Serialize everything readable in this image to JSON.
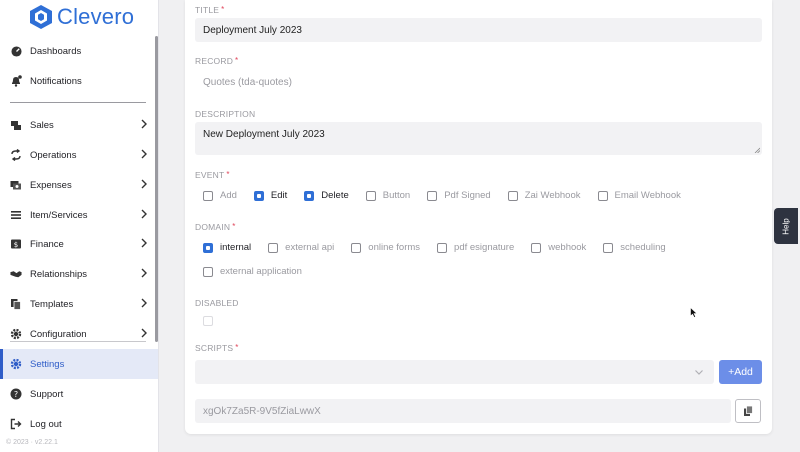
{
  "app": {
    "brand": "Clevero",
    "version": "© 2023 · v2.22.1",
    "accent": "#2f6fd6"
  },
  "sidebar": {
    "items": [
      {
        "label": "Dashboards",
        "icon": "dashboard-icon"
      },
      {
        "label": "Notifications",
        "icon": "bell-icon"
      },
      {
        "label": "Sales",
        "icon": "sales-icon"
      },
      {
        "label": "Operations",
        "icon": "sync-icon"
      },
      {
        "label": "Expenses",
        "icon": "expenses-icon"
      },
      {
        "label": "Item/Services",
        "icon": "list-icon"
      },
      {
        "label": "Finance",
        "icon": "finance-icon"
      },
      {
        "label": "Relationships",
        "icon": "handshake-icon"
      },
      {
        "label": "Templates",
        "icon": "templates-icon"
      },
      {
        "label": "Configuration",
        "icon": "gear-icon"
      },
      {
        "label": "Settings",
        "icon": "gear-icon"
      },
      {
        "label": "Support",
        "icon": "help-circle-icon"
      },
      {
        "label": "Log out",
        "icon": "logout-icon"
      }
    ],
    "active": "Settings"
  },
  "form": {
    "title_label": "TITLE",
    "title_value": "Deployment July 2023",
    "record_label": "RECORD",
    "record_value": "Quotes (tda-quotes)",
    "description_label": "DESCRIPTION",
    "description_value": "New Deployment July 2023",
    "event_label": "EVENT",
    "events": [
      {
        "label": "Add",
        "checked": false
      },
      {
        "label": "Edit",
        "checked": true
      },
      {
        "label": "Delete",
        "checked": true
      },
      {
        "label": "Button",
        "checked": false
      },
      {
        "label": "Pdf Signed",
        "checked": false
      },
      {
        "label": "Zai Webhook",
        "checked": false
      },
      {
        "label": "Email Webhook",
        "checked": false
      }
    ],
    "domain_label": "DOMAIN",
    "domains": [
      {
        "label": "internal",
        "checked": true
      },
      {
        "label": "external api",
        "checked": false
      },
      {
        "label": "online forms",
        "checked": false
      },
      {
        "label": "pdf esignature",
        "checked": false
      },
      {
        "label": "webhook",
        "checked": false
      },
      {
        "label": "scheduling",
        "checked": false
      },
      {
        "label": "external application",
        "checked": false
      }
    ],
    "disabled_label": "DISABLED",
    "scripts_label": "SCRIPTS",
    "add_label": "+Add",
    "token_value": "xgOk7Za5R-9V5fZiaLwwX",
    "required_mark": "*"
  },
  "help": {
    "label": "Help"
  }
}
